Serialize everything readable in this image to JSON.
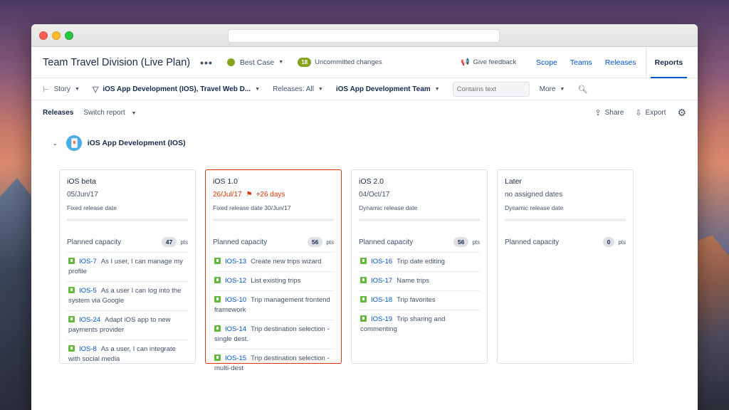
{
  "header": {
    "plan_title": "Team Travel Division (Live Plan)",
    "more_glyph": "•••",
    "scenario": "Best Case",
    "uncommitted_count": "18",
    "uncommitted_label": "Uncommitted changes",
    "feedback_label": "Give feedback",
    "tabs": [
      {
        "label": "Scope"
      },
      {
        "label": "Teams"
      },
      {
        "label": "Releases"
      },
      {
        "label": "Reports"
      }
    ],
    "active_tab": "Reports"
  },
  "filters": {
    "hierarchy": "Story",
    "projects": "iOS App Development (IOS), Travel Web D...",
    "releases": "Releases: All",
    "team": "iOS App Development Team",
    "search_placeholder": "Contains text",
    "more": "More"
  },
  "toolbar": {
    "view_label": "Releases",
    "switch_report": "Switch report",
    "share": "Share",
    "export": "Export"
  },
  "project": {
    "name": "iOS App Development (IOS)"
  },
  "columns": [
    {
      "name": "iOS beta",
      "date": "05/Jun/17",
      "date_extra": "",
      "sub": "Fixed release date",
      "capacity_label": "Planned capacity",
      "capacity": "47",
      "pts_label": "pts",
      "issues": [
        {
          "key": "IOS-7",
          "text": "As I user, I can manage my profile"
        },
        {
          "key": "IOS-5",
          "text": "As a user I can log into the system via Google"
        },
        {
          "key": "IOS-24",
          "text": "Adapt iOS app to new payments provider"
        },
        {
          "key": "IOS-8",
          "text": "As a user, I can integrate with social media"
        }
      ]
    },
    {
      "name": "iOS 1.0",
      "date": "26/Jul/17",
      "date_extra": "+26 days",
      "sub": "Fixed release date 30/Jun/17",
      "capacity_label": "Planned capacity",
      "capacity": "56",
      "pts_label": "pts",
      "issues": [
        {
          "key": "IOS-13",
          "text": "Create new trips wizard"
        },
        {
          "key": "IOS-12",
          "text": "List existing trips"
        },
        {
          "key": "IOS-10",
          "text": "Trip management frontend framework"
        },
        {
          "key": "IOS-14",
          "text": "Trip destination selection - single dest."
        },
        {
          "key": "IOS-15",
          "text": "Trip destination selection - multi-dest"
        }
      ]
    },
    {
      "name": "iOS 2.0",
      "date": "04/Oct/17",
      "date_extra": "",
      "sub": "Dynamic release date",
      "capacity_label": "Planned capacity",
      "capacity": "56",
      "pts_label": "pts",
      "issues": [
        {
          "key": "IOS-16",
          "text": "Trip date editing"
        },
        {
          "key": "IOS-17",
          "text": "Name trips"
        },
        {
          "key": "IOS-18",
          "text": "Trip favorites"
        },
        {
          "key": "IOS-19",
          "text": "Trip sharing and commenting"
        }
      ]
    },
    {
      "name": "Later",
      "date": "no assigned dates",
      "date_extra": "",
      "sub": "Dynamic release date",
      "capacity_label": "Planned capacity",
      "capacity": "0",
      "pts_label": "pts",
      "issues": []
    }
  ],
  "colors": {
    "link": "#0052cc",
    "story": "#63ba3c",
    "alert": "#de350b",
    "scenario": "#84a31d"
  }
}
